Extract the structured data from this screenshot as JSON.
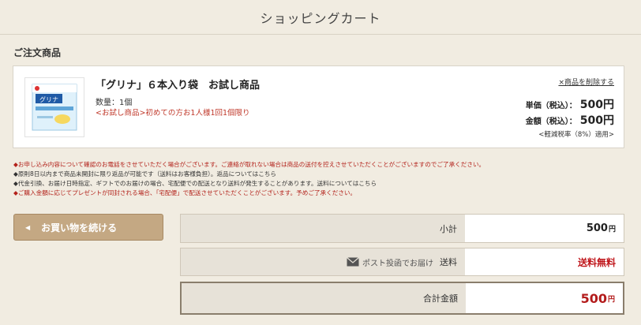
{
  "header": {
    "title": "ショッピングカート"
  },
  "section": {
    "title": "ご注文商品"
  },
  "product": {
    "name": "「グリナ」６本入り袋　お試し商品",
    "quantity": "数量：1個",
    "trial_note": "<お試し商品>初めての方お1人様1回1個限り",
    "remove": "×商品を削除する",
    "unit_price_label": "単価（税込）：",
    "unit_price": "500円",
    "amount_label": "金額（税込）：",
    "amount": "500円",
    "tax_note": "<軽減税率（8%）適用>",
    "thumb_text": "グリナ"
  },
  "notes": [
    "◆お申し込み内容について確認のお電話をさせていただく場合がございます。ご連絡が取れない場合は商品の送付を控えさせていただくことがございますのでご了承ください。",
    "◆原則8日以内まで商品未開封に限り返品が可能です（送料はお客様負担）。返品についてはこちら",
    "◆代金引換、お届け日時指定、ギフトでのお届けの場合、宅配便での配送となり送料が発生することがあります。送料についてはこちら",
    "◆ご購入金額に応じてプレゼントが同封される場合、「宅配便」で配送させていただくことがございます。予めご了承ください。"
  ],
  "continue_button": "お買い物を続ける",
  "summary": {
    "subtotal_label": "小計",
    "subtotal_value": "500",
    "shipping_method": "ポスト投函でお届け",
    "shipping_label": "送料",
    "shipping_value": "送料無料",
    "total_label": "合計金額",
    "total_value": "500",
    "yen": "円"
  }
}
